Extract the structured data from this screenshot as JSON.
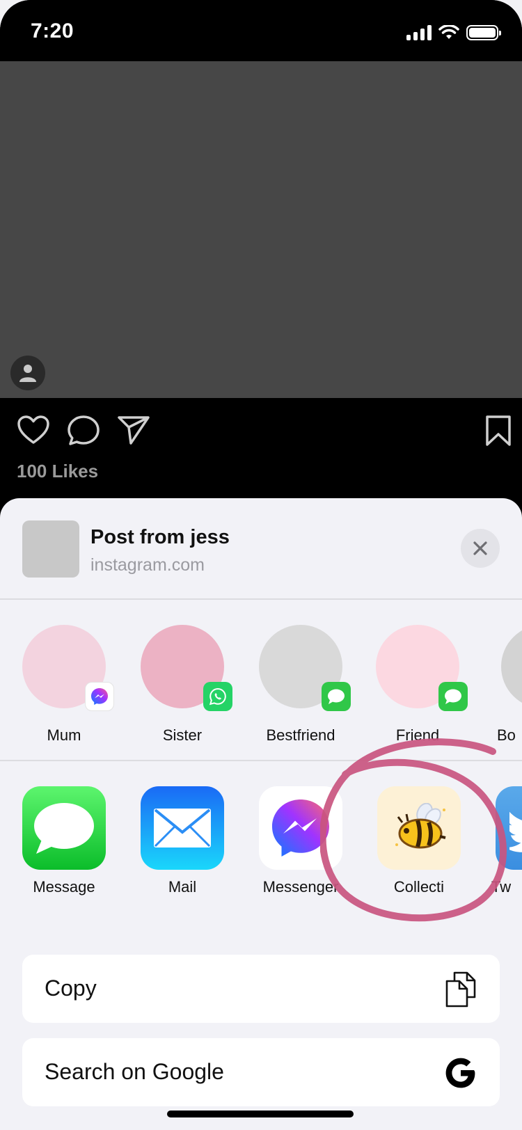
{
  "status_bar": {
    "time": "7:20"
  },
  "post": {
    "likes": "100 Likes"
  },
  "share_sheet": {
    "title": "Post from jess",
    "subtitle": "instagram.com",
    "people": [
      {
        "name": "Mum",
        "badge": "messenger-badge-icon",
        "color": "#f3d3df"
      },
      {
        "name": "Sister",
        "badge": "whatsapp-badge-icon",
        "color": "#ecb2c4"
      },
      {
        "name": "Bestfriend",
        "badge": "messages-badge-icon",
        "color": "#d9d9d9"
      },
      {
        "name": "Friend",
        "badge": "messages-badge-icon",
        "color": "#fcd8e1"
      },
      {
        "name": "Bo",
        "badge": "",
        "color": "#d3d3d3"
      }
    ],
    "apps": [
      {
        "label": "Message",
        "icon": "messages-app-icon"
      },
      {
        "label": "Mail",
        "icon": "mail-app-icon"
      },
      {
        "label": "Messenger",
        "icon": "messenger-app-icon"
      },
      {
        "label": "Collecti",
        "icon": "bee-app-icon"
      },
      {
        "label": "Tw",
        "icon": "twitter-app-icon"
      }
    ],
    "actions": [
      {
        "label": "Copy",
        "icon": "copy-icon"
      },
      {
        "label": "Search on Google",
        "icon": "google-icon"
      }
    ]
  },
  "colors": {
    "annotation_circle": "#c9557f",
    "sheet_background": "#f2f2f7",
    "post_image": "#474747"
  }
}
